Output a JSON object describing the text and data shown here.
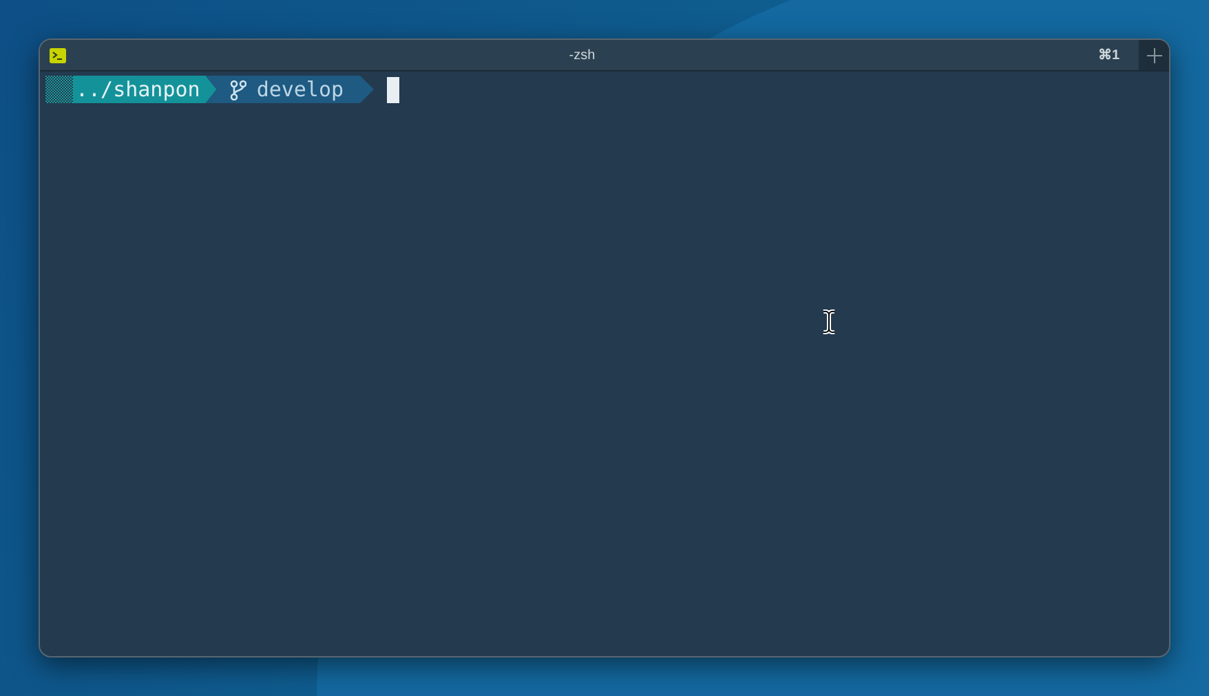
{
  "window": {
    "title": "-zsh",
    "shortcut": "⌘1"
  },
  "prompt": {
    "path": "../shanpon",
    "branch": "develop"
  }
}
